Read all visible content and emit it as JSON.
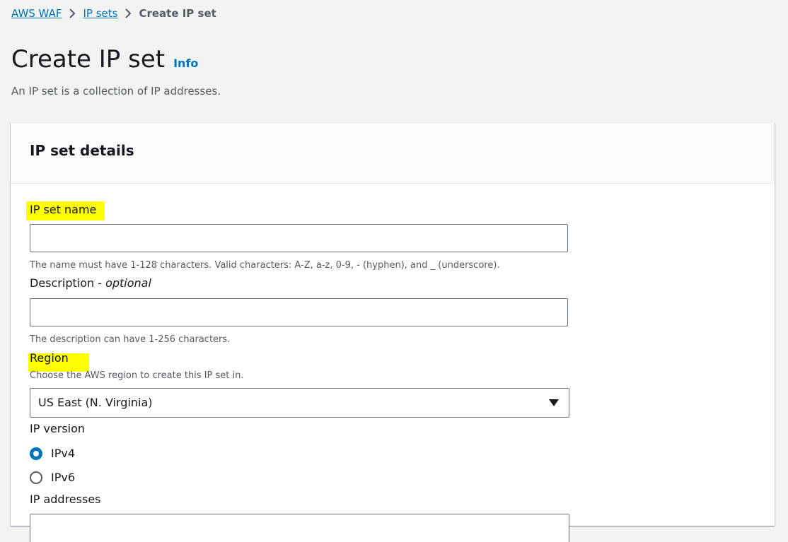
{
  "breadcrumb": {
    "items": [
      {
        "label": "AWS WAF"
      },
      {
        "label": "IP sets"
      }
    ],
    "current": "Create IP set"
  },
  "header": {
    "title": "Create IP set",
    "info_label": "Info",
    "description": "An IP set is a collection of IP addresses."
  },
  "panel": {
    "title": "IP set details"
  },
  "form": {
    "name": {
      "label": "IP set name",
      "value": "",
      "hint": "The name must have 1-128 characters. Valid characters: A-Z, a-z, 0-9, - (hyphen), and _ (underscore)."
    },
    "description": {
      "label": "Description - ",
      "optional": "optional",
      "value": "",
      "hint": "The description can have 1-256 characters."
    },
    "region": {
      "label": "Region",
      "hint": "Choose the AWS region to create this IP set in.",
      "selected": "US East (N. Virginia)"
    },
    "ip_version": {
      "label": "IP version",
      "options": [
        {
          "label": "IPv4",
          "checked": true
        },
        {
          "label": "IPv6",
          "checked": false
        }
      ]
    },
    "ip_addresses": {
      "label": "IP addresses"
    }
  },
  "colors": {
    "link": "#0073bb",
    "highlight": "#ffff00",
    "page_bg": "#f2f3f3",
    "text": "#16191f",
    "muted": "#545b64"
  },
  "icons": {
    "breadcrumb_separator": "chevron-right-icon",
    "select_caret": "caret-down-icon"
  }
}
